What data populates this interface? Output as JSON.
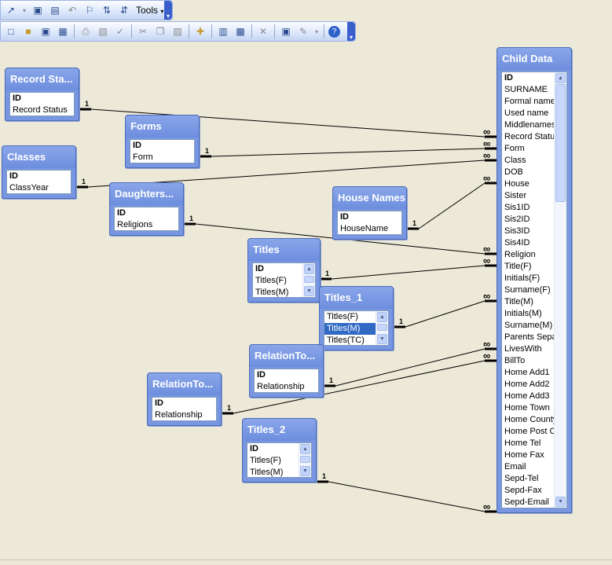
{
  "toolbar": {
    "row1": [
      "chart-icon",
      "save-icon",
      "save-as-icon",
      "undo-icon",
      "find-icon",
      "sort-ascending-icon",
      "sort-descending-icon"
    ],
    "tools_label": "Tools",
    "row2": [
      "new-icon",
      "open-icon",
      "save-icon",
      "print-preview-icon",
      "print-icon",
      "preview-icon",
      "spelling-icon",
      "cut-icon",
      "copy-icon",
      "paste-icon",
      "show-table-icon",
      "direct-relationships-icon",
      "all-relationships-icon",
      "delete-icon",
      "new-object-icon",
      "office-links-icon",
      "help-icon"
    ]
  },
  "tables": {
    "record_status": {
      "title": "Record Sta...",
      "fields": [
        "ID",
        "Record Status"
      ]
    },
    "forms": {
      "title": "Forms",
      "fields": [
        "ID",
        "Form"
      ]
    },
    "classes": {
      "title": "Classes",
      "fields": [
        "ID",
        "ClassYear"
      ]
    },
    "daughters": {
      "title": "Daughters...",
      "fields": [
        "ID",
        "Religions"
      ]
    },
    "house_names": {
      "title": "House Names",
      "fields": [
        "ID",
        "HouseName"
      ]
    },
    "titles": {
      "title": "Titles",
      "fields": [
        "ID",
        "Titles(F)",
        "Titles(M)"
      ]
    },
    "titles_1": {
      "title": "Titles_1",
      "fields": [
        "Titles(F)",
        "Titles(M)",
        "Titles(TC)"
      ]
    },
    "relation_to_a": {
      "title": "RelationTo...",
      "fields": [
        "ID",
        "Relationship"
      ]
    },
    "relation_to_b": {
      "title": "RelationTo...",
      "fields": [
        "ID",
        "Relationship"
      ]
    },
    "titles_2": {
      "title": "Titles_2",
      "fields": [
        "ID",
        "Titles(F)",
        "Titles(M)"
      ]
    },
    "child_data": {
      "title": "Child Data",
      "fields": [
        "ID",
        "SURNAME",
        "Formal name",
        "Used name",
        "Middlenames",
        "Record Status",
        "Form",
        "Class",
        "DOB",
        "House",
        "Sister",
        "Sis1ID",
        "Sis2ID",
        "Sis3ID",
        "Sis4ID",
        "Religion",
        "Title(F)",
        "Initials(F)",
        "Surname(F)",
        "Title(M)",
        "Initials(M)",
        "Surname(M)",
        "Parents Separ",
        "LivesWith",
        "BillTo",
        "Home Add1",
        "Home Add2",
        "Home Add3",
        "Home Town",
        "Home County",
        "Home Post Cc",
        "Home Tel",
        "Home Fax",
        "Email",
        "Sepd-Tel",
        "Sepd-Fax",
        "Sepd-Email"
      ]
    }
  },
  "relationship_labels": {
    "one": "1",
    "many": "∞"
  }
}
